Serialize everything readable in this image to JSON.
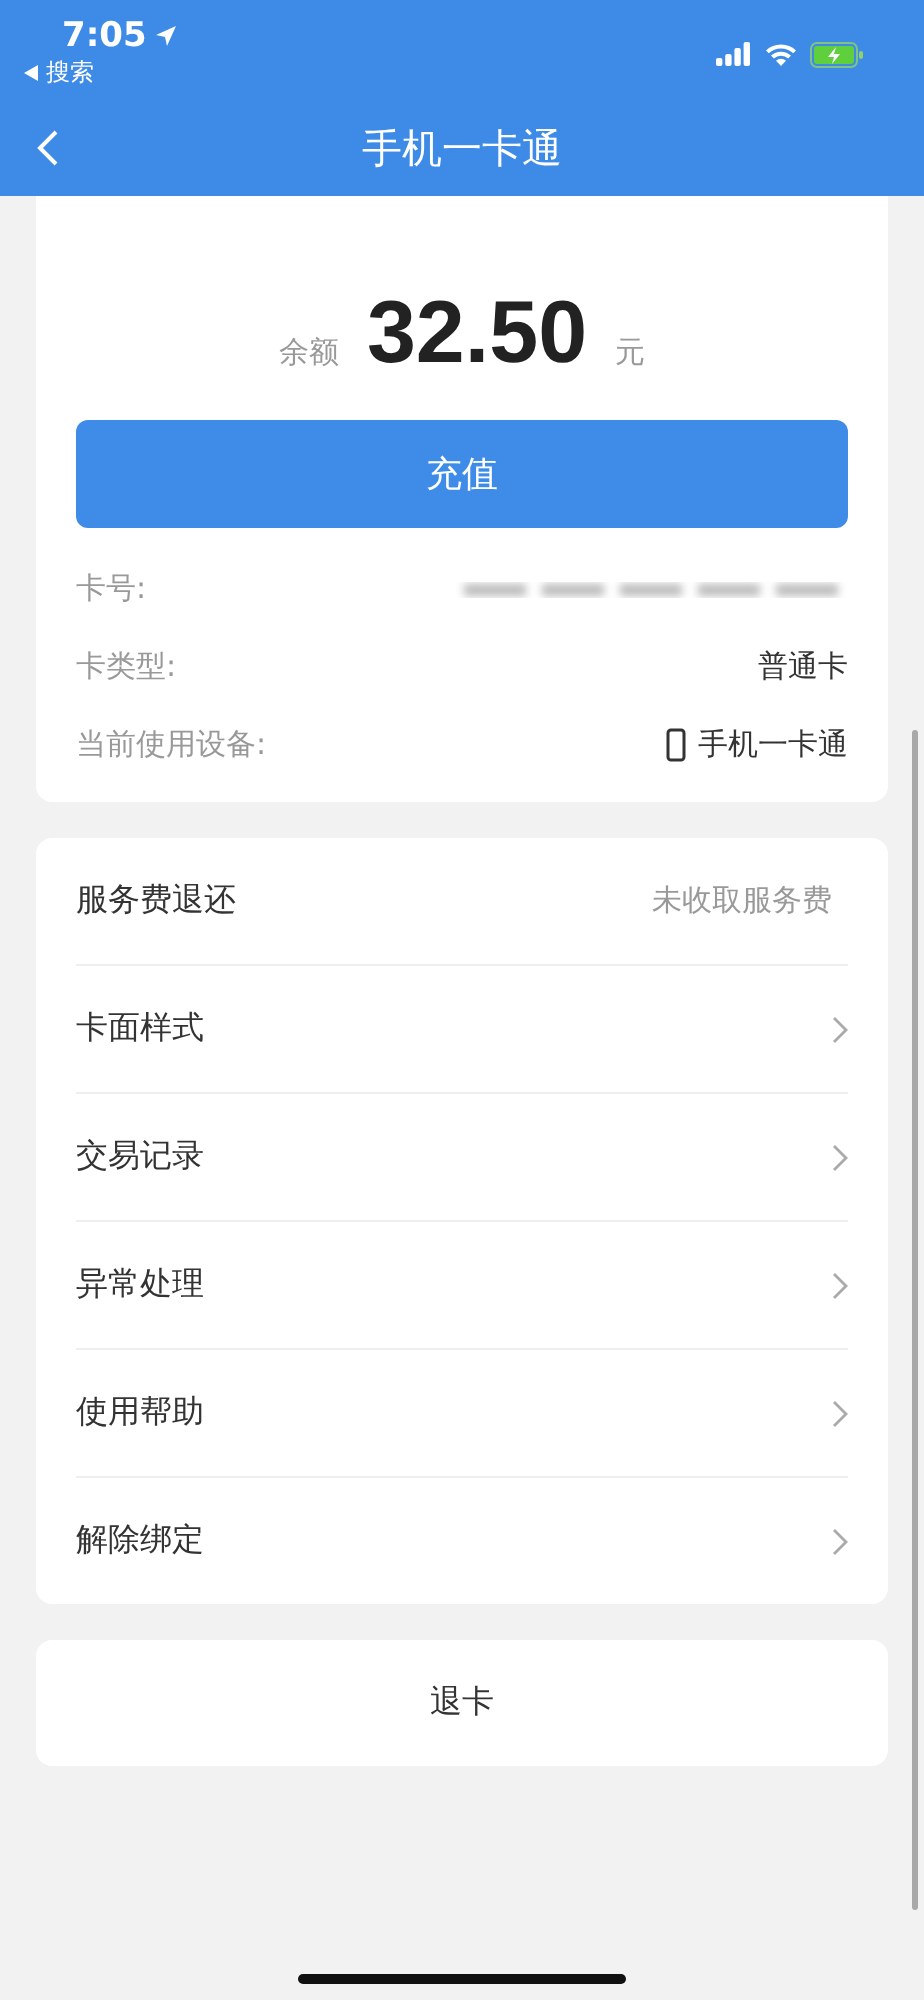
{
  "status_bar": {
    "time": "7:05",
    "back_app": "搜索"
  },
  "nav": {
    "title": "手机一卡通"
  },
  "balance": {
    "label": "余额",
    "amount": "32.50",
    "unit": "元"
  },
  "recharge_button": "充值",
  "details": [
    {
      "kind": "blurred",
      "label": "卡号:"
    },
    {
      "kind": "text",
      "label": "卡类型:",
      "value": "普通卡"
    },
    {
      "kind": "device",
      "label": "当前使用设备:",
      "value": "手机一卡通"
    }
  ],
  "menu": [
    {
      "kind": "value",
      "label": "服务费退还",
      "value": "未收取服务费"
    },
    {
      "kind": "link",
      "label": "卡面样式"
    },
    {
      "kind": "link",
      "label": "交易记录"
    },
    {
      "kind": "link",
      "label": "异常处理"
    },
    {
      "kind": "link",
      "label": "使用帮助"
    },
    {
      "kind": "link",
      "label": "解除绑定"
    }
  ],
  "return_button": "退卡"
}
